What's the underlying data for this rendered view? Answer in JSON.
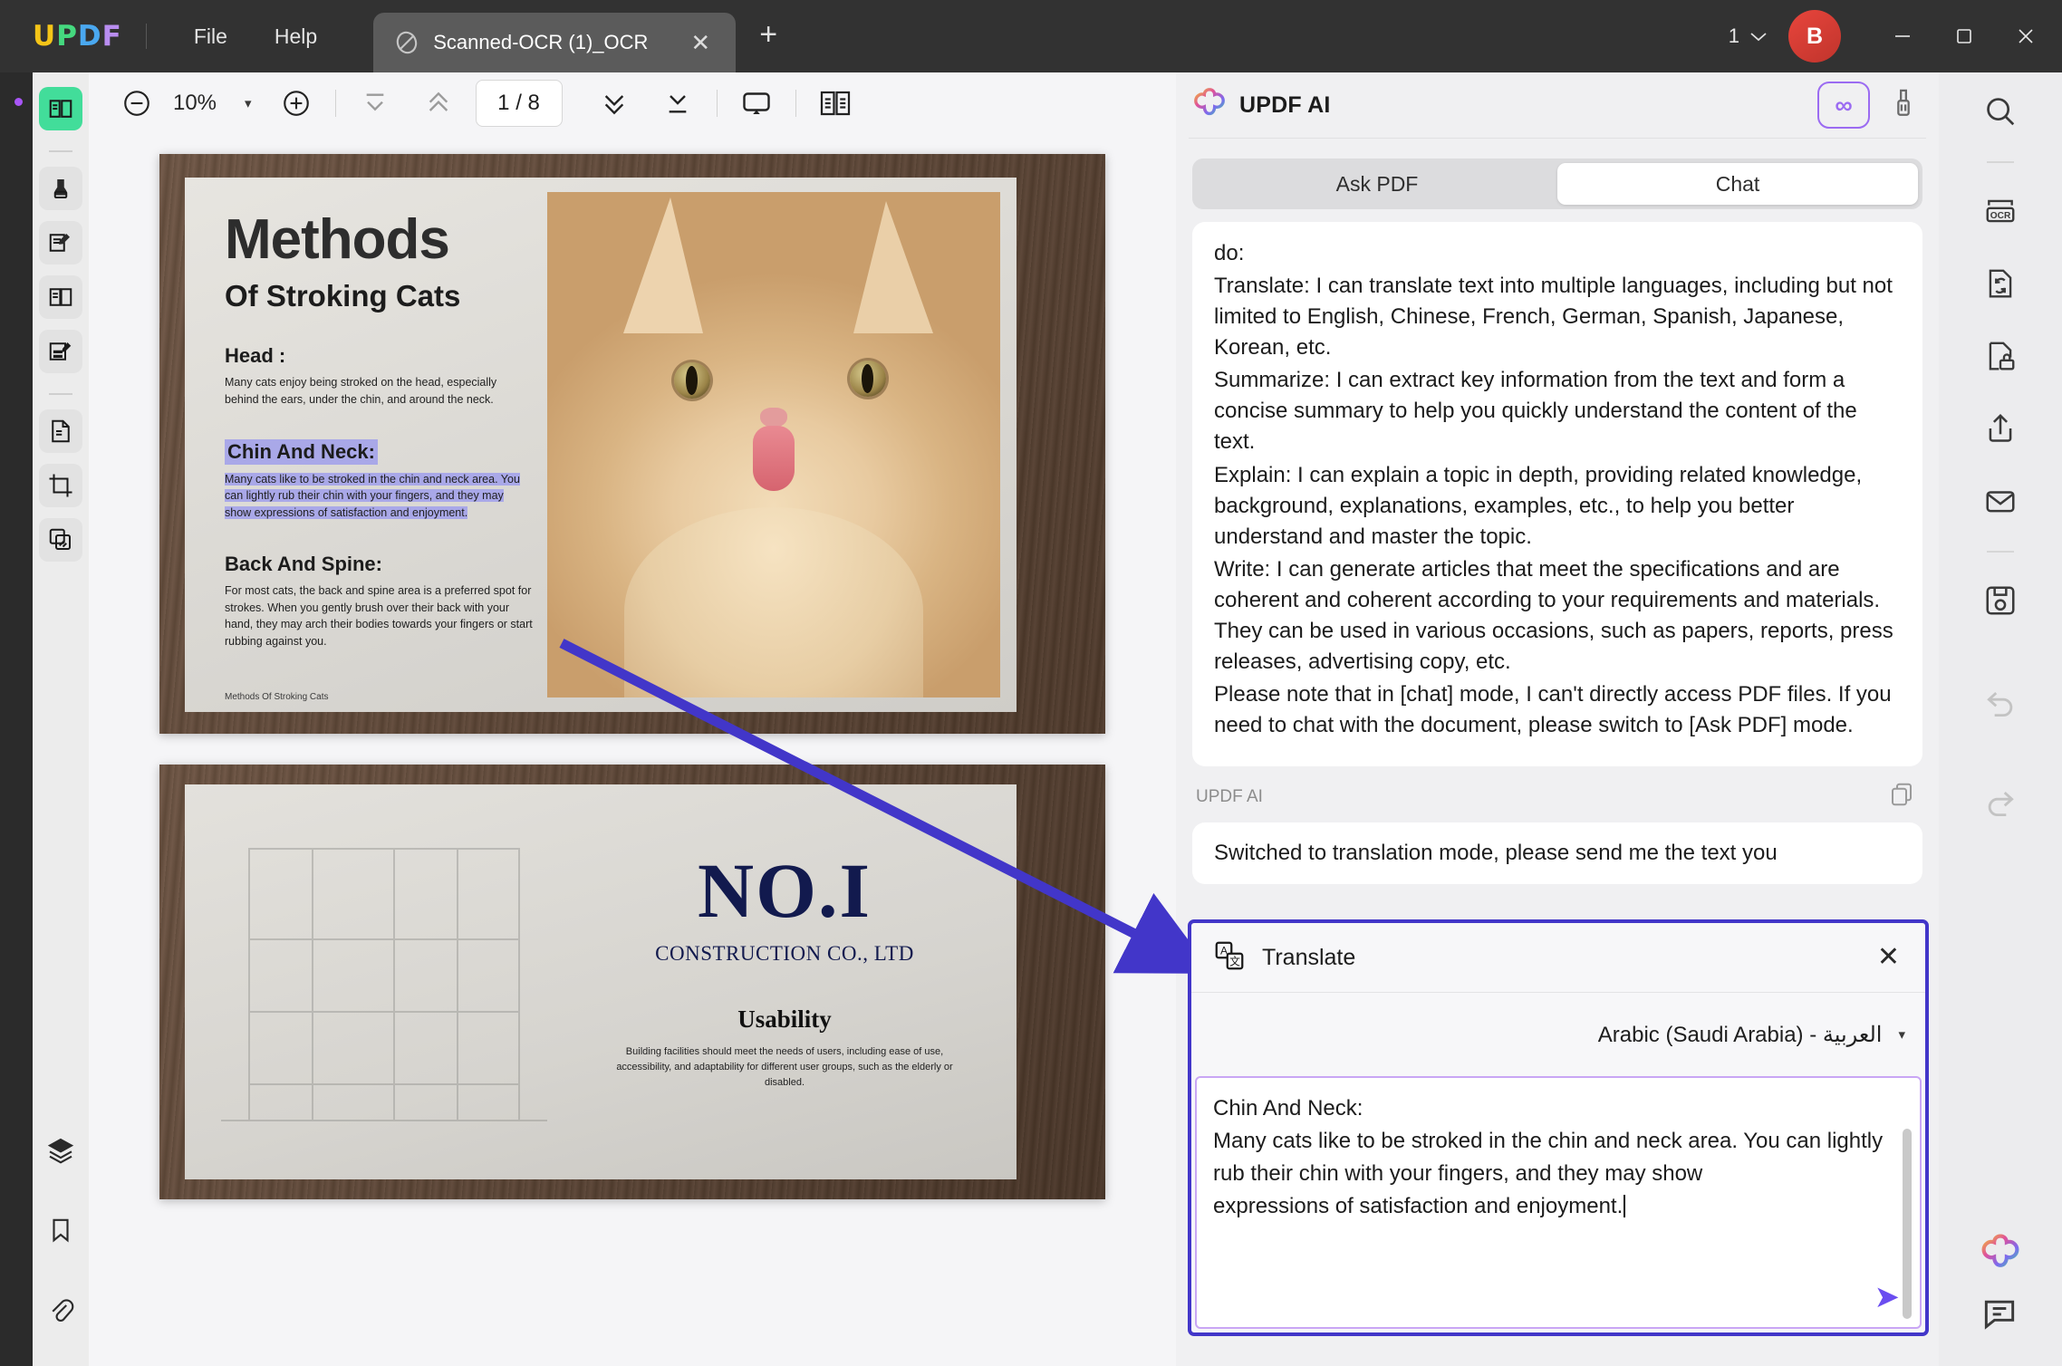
{
  "window": {
    "logo": {
      "l1": "U",
      "l2": "P",
      "l3": "D",
      "l4": "F"
    },
    "menus": [
      "File",
      "Help"
    ],
    "tab_title": "Scanned-OCR (1)_OCR",
    "tab_close": "✕",
    "new_tab": "+",
    "window_count": "1",
    "avatar_initial": "B",
    "minimize": "—",
    "maximize": "☐",
    "close": "✕"
  },
  "toolbar": {
    "zoom_out": "zoom-out-icon",
    "zoom_value": "10%",
    "zoom_caret": "▾",
    "zoom_in": "zoom-in-icon",
    "first_page": "first-page-icon",
    "prev_page": "prev-page-icon",
    "page_indicator": "1 / 8",
    "next_page": "next-page-icon",
    "last_page": "last-page-icon",
    "presentation": "presentation-icon",
    "page_layout": "page-layout-icon"
  },
  "left_tools": [
    {
      "name": "reader-mode",
      "active": true
    },
    {
      "name": "highlighter",
      "active": false
    },
    {
      "name": "edit-text",
      "active": false
    },
    {
      "name": "page-edit",
      "active": false
    },
    {
      "name": "form-fill",
      "active": false
    },
    {
      "name": "page-extract",
      "active": false
    },
    {
      "name": "crop",
      "active": false
    },
    {
      "name": "organize-pages",
      "active": false
    },
    {
      "name": "layers",
      "active": false
    },
    {
      "name": "bookmark",
      "active": false
    },
    {
      "name": "attachment",
      "active": false
    }
  ],
  "right_tools": [
    {
      "name": "search",
      "dim": false
    },
    {
      "name": "ocr",
      "dim": false
    },
    {
      "name": "convert",
      "dim": false
    },
    {
      "name": "protect",
      "dim": false
    },
    {
      "name": "share",
      "dim": false
    },
    {
      "name": "email",
      "dim": false
    },
    {
      "name": "save",
      "dim": false
    },
    {
      "name": "undo",
      "dim": true
    },
    {
      "name": "redo",
      "dim": true
    }
  ],
  "ai": {
    "title": "UPDF AI",
    "infinity_label": "∞",
    "brush": "brush-icon",
    "tabs": [
      {
        "label": "Ask PDF",
        "active": false
      },
      {
        "label": "Chat",
        "active": true
      }
    ],
    "message_lines": [
      "do:",
      "Translate: I can translate text into multiple languages, including but not limited to English, Chinese, French, German, Spanish, Japanese, Korean, etc.",
      "Summarize: I can extract key information from the text and form a concise summary to help you quickly understand the content of the text.",
      "Explain: I can explain a topic in depth, providing related knowledge, background, explanations, examples, etc., to help you better understand and master the topic.",
      "Write: I can generate articles that meet the specifications and are coherent and coherent according to your requirements and materials. They can be used in various occasions, such as papers, reports, press releases, advertising copy, etc.",
      "Please note that in [chat] mode, I can't directly access PDF files. If you need to chat with the document, please switch to [Ask PDF] mode."
    ],
    "sender_label": "UPDF AI",
    "copy_icon": "copy-icon",
    "next_message": "Switched to translation mode, please send me the text you"
  },
  "translate": {
    "icon": "translate-icon",
    "title": "Translate",
    "close": "✕",
    "language": "Arabic (Saudi Arabia) - العربية",
    "language_caret": "▾",
    "text_lines": [
      "Chin And Neck:",
      "Many cats like to be stroked in the chin and neck area. You can lightly",
      "rub their chin with your fingers, and they may show",
      "expressions of satisfaction and enjoyment."
    ],
    "send": "➤"
  },
  "document": {
    "page1": {
      "title": "Methods",
      "subtitle": "Of Stroking Cats",
      "sections": [
        {
          "heading": "Head :",
          "body": "Many cats enjoy being stroked on the head, especially behind the ears, under the chin, and around the neck.",
          "highlighted": false
        },
        {
          "heading": "Chin And Neck:",
          "body": "Many cats like to be stroked in the chin and neck area. You can lightly rub their chin with your fingers, and they may show expressions of satisfaction and enjoyment.",
          "highlighted": true
        },
        {
          "heading": "Back And Spine:",
          "body": "For most cats, the back and spine area is a preferred spot for strokes. When you gently brush over their back with your hand, they may arch their bodies towards your fingers or start rubbing against you.",
          "highlighted": false
        }
      ],
      "footer": "Methods Of Stroking Cats"
    },
    "page2": {
      "number": "NO.I",
      "company": "CONSTRUCTION CO., LTD",
      "heading": "Usability",
      "body": "Building facilities should meet the needs of users, including ease of use, accessibility, and adaptability for different user groups, such as the elderly or disabled."
    }
  },
  "colors": {
    "accent_purple": "#6a4df0",
    "dialog_border": "#4236c9",
    "active_green": "#42dd9a",
    "highlight": "#a9a8e8"
  }
}
